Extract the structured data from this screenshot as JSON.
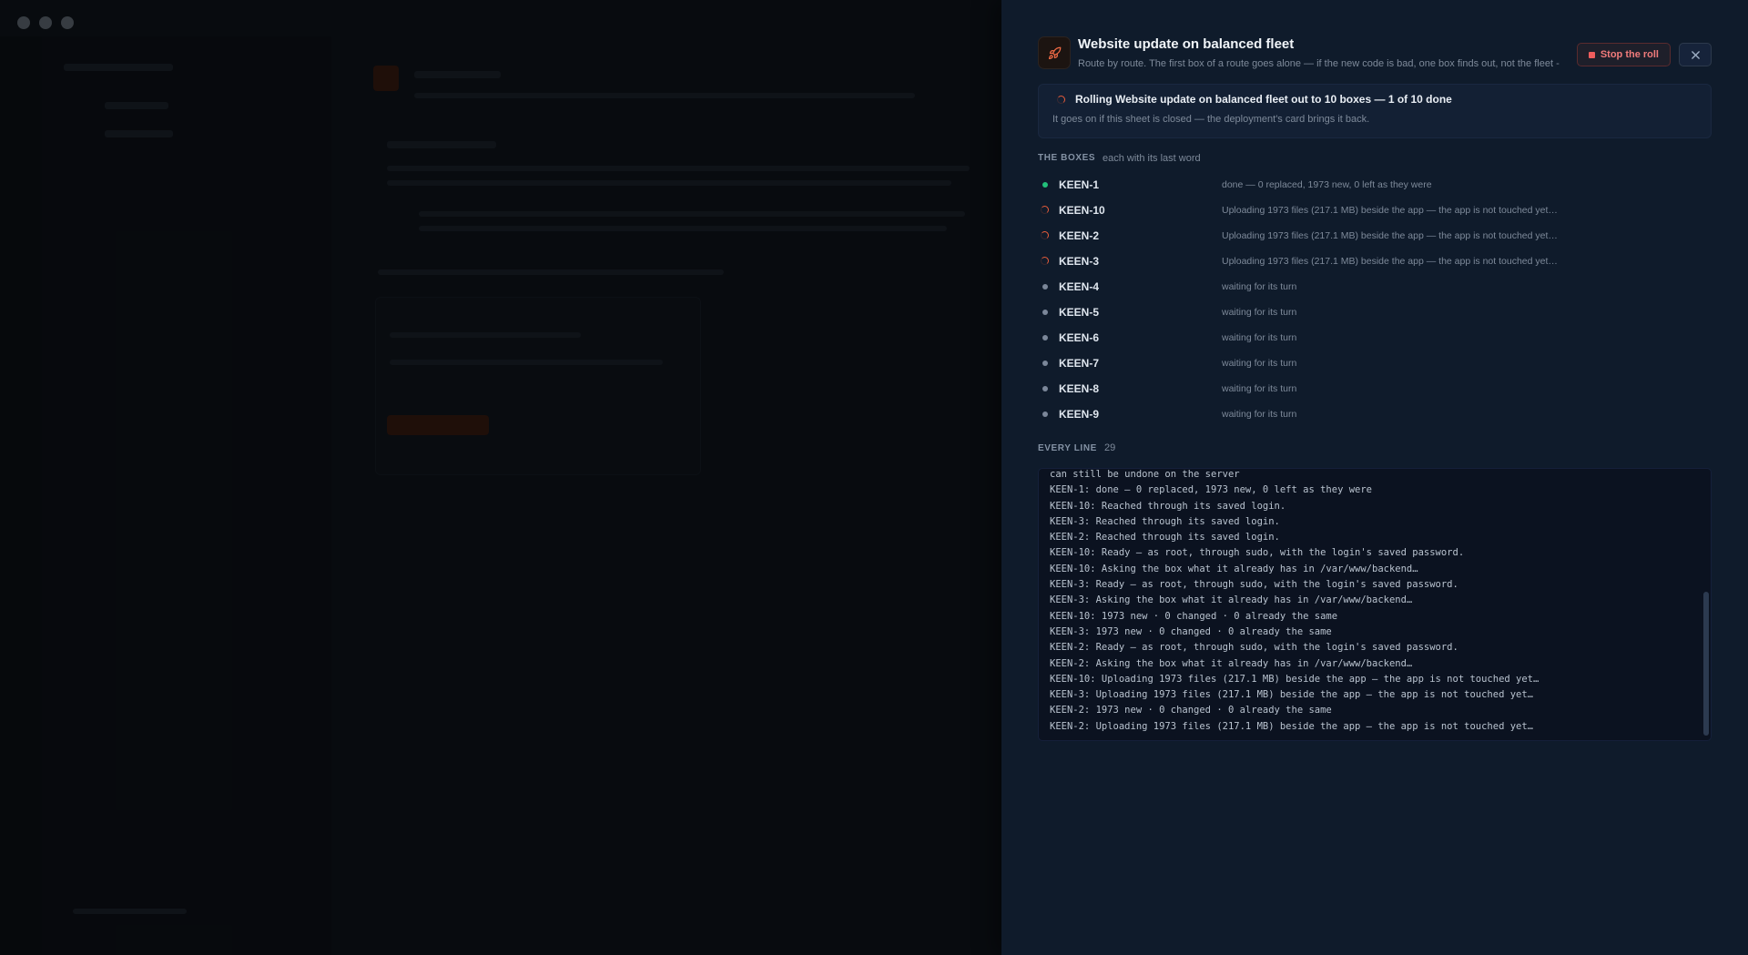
{
  "sheet": {
    "title": "Website update on balanced fleet",
    "subtitle": "Route by route. The first box of a route goes alone — if the new code is bad, one box finds out, not the fleet -",
    "stop_label": "Stop the roll",
    "status": {
      "title": "Rolling Website update on balanced fleet out to 10 boxes — 1 of 10 done",
      "subtitle": "It goes on if this sheet is closed — the deployment's card brings it back."
    },
    "boxes_section": {
      "label": "THE BOXES",
      "note": "each with its last word"
    },
    "boxes": [
      {
        "name": "KEEN-1",
        "state": "done",
        "message": "done — 0 replaced, 1973 new, 0 left as they were"
      },
      {
        "name": "KEEN-10",
        "state": "running",
        "message": "Uploading 1973 files (217.1 MB) beside the app — the app is not touched yet…"
      },
      {
        "name": "KEEN-2",
        "state": "running",
        "message": "Uploading 1973 files (217.1 MB) beside the app — the app is not touched yet…"
      },
      {
        "name": "KEEN-3",
        "state": "running",
        "message": "Uploading 1973 files (217.1 MB) beside the app — the app is not touched yet…"
      },
      {
        "name": "KEEN-4",
        "state": "waiting",
        "message": "waiting for its turn"
      },
      {
        "name": "KEEN-5",
        "state": "waiting",
        "message": "waiting for its turn"
      },
      {
        "name": "KEEN-6",
        "state": "waiting",
        "message": "waiting for its turn"
      },
      {
        "name": "KEEN-7",
        "state": "waiting",
        "message": "waiting for its turn"
      },
      {
        "name": "KEEN-8",
        "state": "waiting",
        "message": "waiting for its turn"
      },
      {
        "name": "KEEN-9",
        "state": "waiting",
        "message": "waiting for its turn"
      }
    ],
    "log_section": {
      "label": "EVERY LINE",
      "count": "29"
    },
    "log_lines": [
      "can still be undone on the server",
      "KEEN-1: done — 0 replaced, 1973 new, 0 left as they were",
      "KEEN-10: Reached through its saved login.",
      "KEEN-3: Reached through its saved login.",
      "KEEN-2: Reached through its saved login.",
      "KEEN-10: Ready — as root, through sudo, with the login's saved password.",
      "KEEN-10: Asking the box what it already has in /var/www/backend…",
      "KEEN-3: Ready — as root, through sudo, with the login's saved password.",
      "KEEN-3: Asking the box what it already has in /var/www/backend…",
      "KEEN-10: 1973 new · 0 changed · 0 already the same",
      "KEEN-3: 1973 new · 0 changed · 0 already the same",
      "KEEN-2: Ready — as root, through sudo, with the login's saved password.",
      "KEEN-2: Asking the box what it already has in /var/www/backend…",
      "KEEN-10: Uploading 1973 files (217.1 MB) beside the app — the app is not touched yet…",
      "KEEN-3: Uploading 1973 files (217.1 MB) beside the app — the app is not touched yet…",
      "KEEN-2: 1973 new · 0 changed · 0 already the same",
      "KEEN-2: Uploading 1973 files (217.1 MB) beside the app — the app is not touched yet…"
    ],
    "colors": {
      "accent": "#e85c3a",
      "done": "#22c07a",
      "danger": "#ef5d5d",
      "sheet_bg": "#0f1b2b"
    },
    "icons": {
      "header": "rocket-icon",
      "close": "close-icon",
      "stop": "stop-icon",
      "running": "spinner-icon",
      "done": "done-dot-icon",
      "waiting": "waiting-dot-icon"
    }
  }
}
